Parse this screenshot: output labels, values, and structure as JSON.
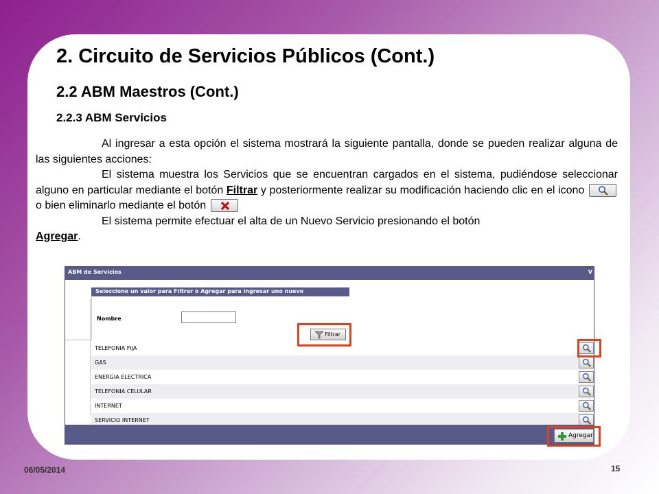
{
  "slide": {
    "title": "2. Circuito de Servicios Públicos (Cont.)",
    "subtitle": "2.2 ABM Maestros (Cont.)",
    "section": "2.2.3 ABM Servicios",
    "p1": "Al ingresar a esta opción el sistema mostrará la siguiente pantalla, donde se pueden realizar alguna de las siguientes acciones:",
    "p2_a": "El sistema muestra los Servicios que se encuentran cargados en el sistema, pudiéndose seleccionar alguno en particular mediante el botón ",
    "p2_filtrar": "Filtrar",
    "p2_b": " y posteriormente realizar su modificación haciendo clic en el icono ",
    "p2_c": " o bien eliminarlo mediante el botón ",
    "p3_a": "El sistema permite efectuar el alta de un  Nuevo Servicio presionando el botón ",
    "p3_agregar": "Agregar",
    "p3_end": ".",
    "date": "06/05/2014",
    "page": "15"
  },
  "app": {
    "title": "ABM de Servicios",
    "corner": "V",
    "filter_header": "Seleccione un valor para Filtrar o Agregar para ingresar uno nuevo",
    "nombre_label": "Nombre",
    "nombre_value": "",
    "filtrar_label": "Filtrar",
    "agregar_label": "Agregar",
    "rows": [
      "TELEFONIA FIJA",
      "GAS",
      "ENERGIA ELECTRICA",
      "TELEFONIA CELULAR",
      "INTERNET",
      "SERVICIO INTERNET"
    ]
  },
  "colors": {
    "highlight": "#e0401a",
    "app_header": "#59598a"
  },
  "icons": {
    "edit": "magnifier-icon",
    "delete": "red-x-icon",
    "add": "green-plus-icon"
  }
}
